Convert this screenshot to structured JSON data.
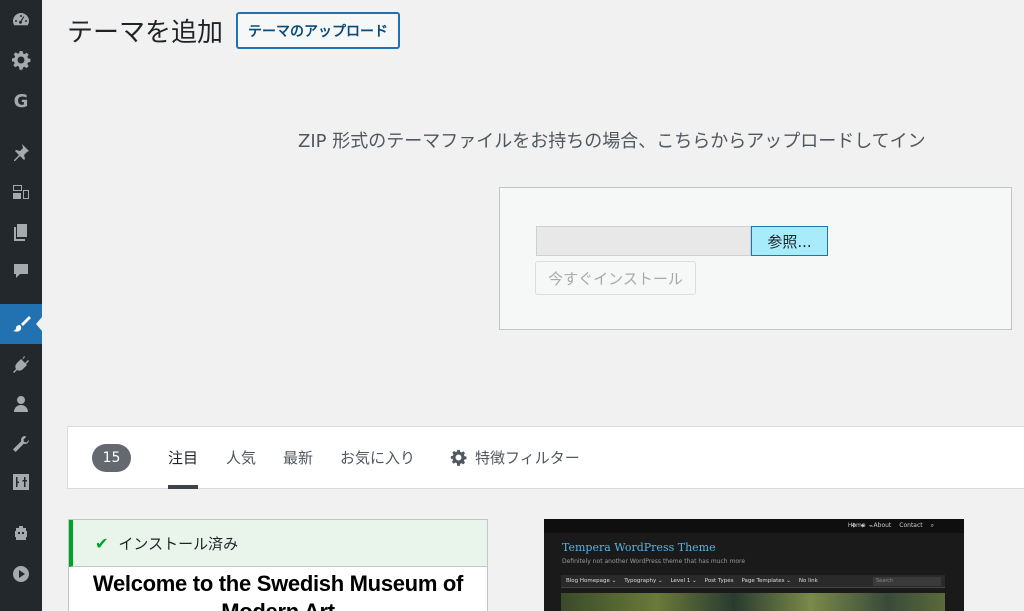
{
  "sidebar": {
    "items": [
      {
        "icon": "dashboard-icon"
      },
      {
        "icon": "settings-gear-icon"
      },
      {
        "icon": "google-g-icon",
        "glyph": "G"
      },
      {
        "icon": "pin-icon"
      },
      {
        "icon": "media-icon"
      },
      {
        "icon": "pages-icon"
      },
      {
        "icon": "comments-icon"
      },
      {
        "icon": "appearance-brush-icon",
        "active": true
      },
      {
        "icon": "plugins-icon"
      },
      {
        "icon": "users-icon"
      },
      {
        "icon": "tools-wrench-icon"
      },
      {
        "icon": "settings-sliders-icon"
      },
      {
        "icon": "robot-icon"
      },
      {
        "icon": "collapse-play-icon"
      }
    ],
    "colors": {
      "background": "#23282d",
      "active": "#2271b1"
    }
  },
  "header": {
    "title": "テーマを追加",
    "upload_button": "テーマのアップロード"
  },
  "upload": {
    "description": "ZIP 形式のテーマファイルをお持ちの場合、こちらからアップロードしてイン",
    "browse_button": "参照...",
    "install_button": "今すぐインストール"
  },
  "filter_bar": {
    "count": "15",
    "tabs": [
      {
        "label": "注目",
        "current": true
      },
      {
        "label": "人気",
        "current": false
      },
      {
        "label": "最新",
        "current": false
      },
      {
        "label": "お気に入り",
        "current": false
      }
    ],
    "feature_filter": "特徴フィルター"
  },
  "themes": [
    {
      "notice": "インストール済み",
      "preview_heading": "Welcome to the Swedish Museum of Modern Art"
    },
    {
      "preview_title": "Tempera WordPress Theme",
      "preview_tagline": "Definitely not another WordPress theme that has much more",
      "preview_topnav": [
        "Home",
        "About",
        "Contact"
      ],
      "preview_menu": [
        "Blog Homepage ⌄",
        "Typography ⌄",
        "Level 1 ⌄",
        "Post Types",
        "Page Templates ⌄",
        "No link"
      ],
      "preview_search": "Search"
    }
  ],
  "colors": {
    "accent": "#2271b1",
    "installed_green": "#00a32a",
    "browse_highlight": "#a8ecfb"
  }
}
